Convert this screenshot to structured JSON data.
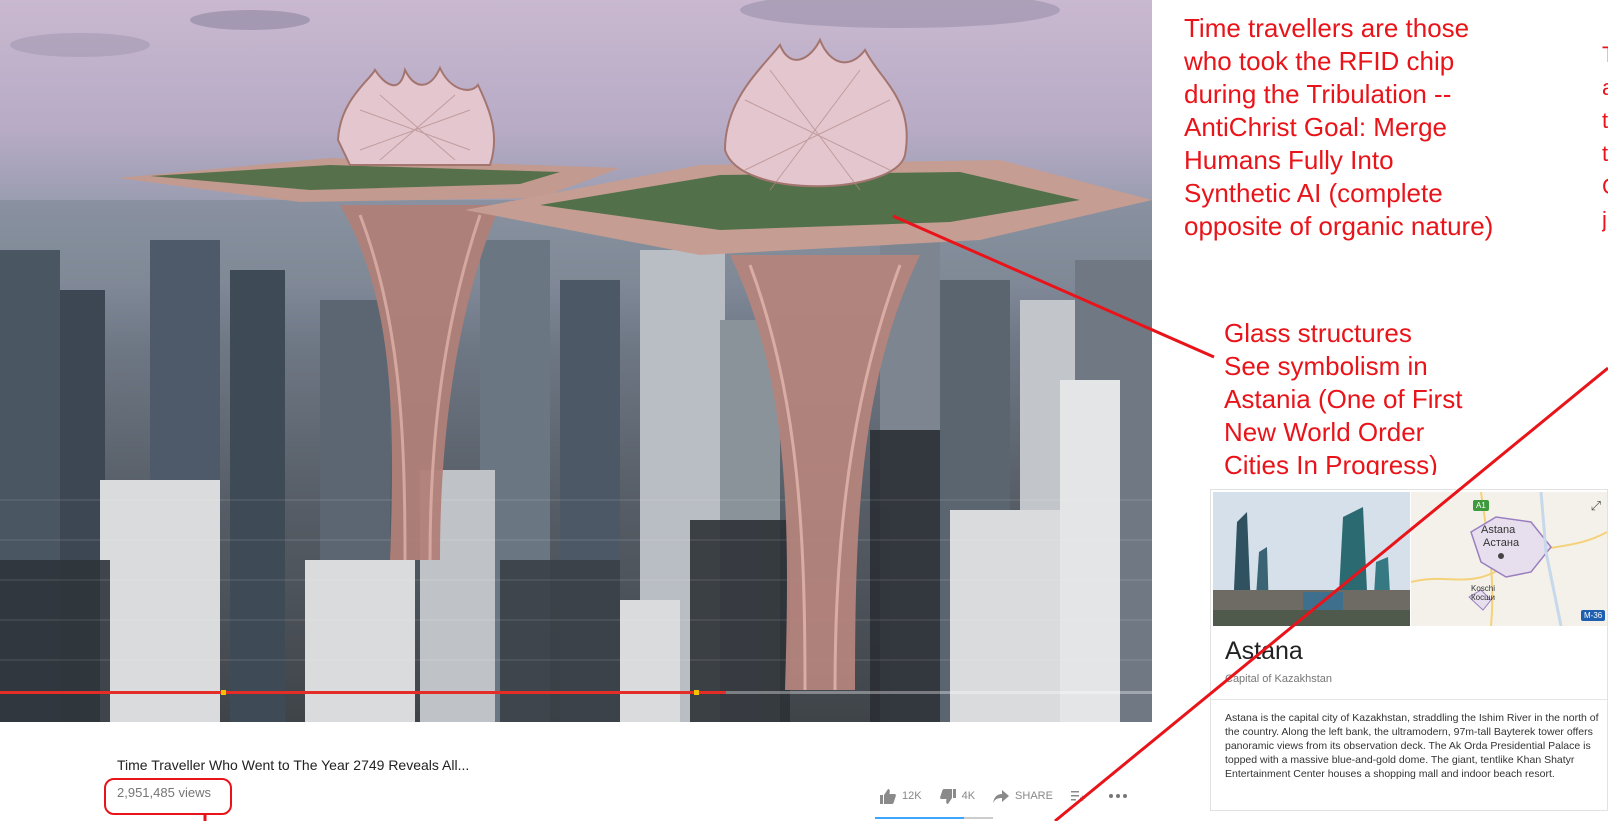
{
  "video": {
    "title": "Time Traveller Who Went to The Year 2749 Reveals All...",
    "views": "2,951,485 views",
    "progress_fraction": 0.63,
    "likes": "12K",
    "dislikes": "4K",
    "share_label": "SHARE",
    "like_ratio": 0.75,
    "icons": [
      "thumbs-up-icon",
      "thumbs-down-icon",
      "share-icon",
      "add-to-playlist-icon",
      "more-icon"
    ]
  },
  "annotations": {
    "note_1": "Time travellers are those\nwho took the RFID chip\nduring the Tribulation --\nAntiChrist Goal: Merge\nHumans Fully Into\nSynthetic AI (complete\nopposite of organic nature)",
    "note_2": "Glass structures\nSee symbolism in\nAstania (One of First\nNew World Order\nCities In Progress)",
    "note_3": "T\na\nt\nt\nC\nj",
    "color": "#e8141a"
  },
  "knowledge_panel": {
    "name": "Astana",
    "subtitle": "Capital of Kazakhstan",
    "description": "Astana is the capital city of Kazakhstan, straddling the Ishim River in the north of the country. Along the left bank, the ultramodern, 97m-tall Bayterek tower offers panoramic views from its observation deck. The Ak Orda Presidential Palace is topped with a massive blue-and-gold dome. The giant, tentlike Khan Shatyr Entertainment Center houses a shopping mall and indoor beach resort.",
    "map": {
      "city_label_latin": "Astana",
      "city_label_cyrillic": "Астана",
      "town_label_latin": "Koschi",
      "town_label_cyrillic": "Косши",
      "road_badge_1": "A1",
      "road_badge_2": "M-36"
    }
  }
}
